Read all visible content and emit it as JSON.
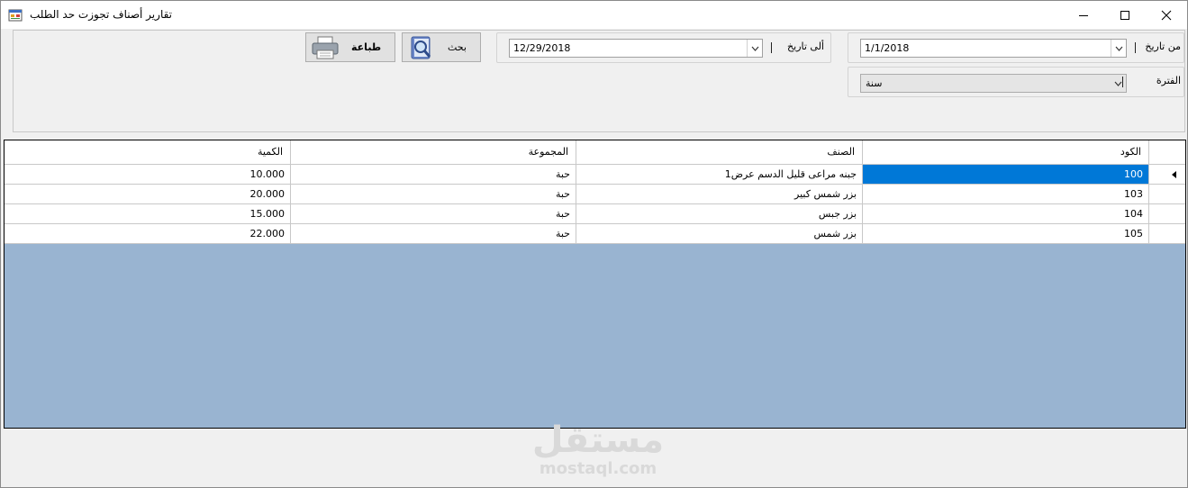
{
  "window": {
    "title": "تقارير أصناف تجوزت حد الطلب"
  },
  "filters": {
    "from_date_label": "من تاريخ",
    "from_date_value": "1/1/2018",
    "to_date_label": "ألى تاريخ",
    "to_date_value": "12/29/2018",
    "period_label": "الفترة",
    "period_value": "سنة"
  },
  "toolbar": {
    "search_label": "بحث",
    "print_label": "طباعة"
  },
  "grid": {
    "columns": {
      "code": "الكود",
      "item": "الصنف",
      "group": "المجموعة",
      "quantity": "الكمية"
    },
    "rows": [
      {
        "code": "100",
        "item": "جبنه مراعى قليل الدسم عرض1",
        "group": "حبة",
        "quantity": "10.000"
      },
      {
        "code": "103",
        "item": "بزر شمس كبير",
        "group": "حبة",
        "quantity": "20.000"
      },
      {
        "code": "104",
        "item": "بزر جبس",
        "group": "حبة",
        "quantity": "15.000"
      },
      {
        "code": "105",
        "item": "بزر شمس",
        "group": "حبة",
        "quantity": "22.000"
      }
    ]
  },
  "watermark": {
    "arabic": "مستقل",
    "latin": "mostaql.com"
  },
  "colors": {
    "selection": "#0078d7",
    "grid_background": "#99b4d1"
  }
}
